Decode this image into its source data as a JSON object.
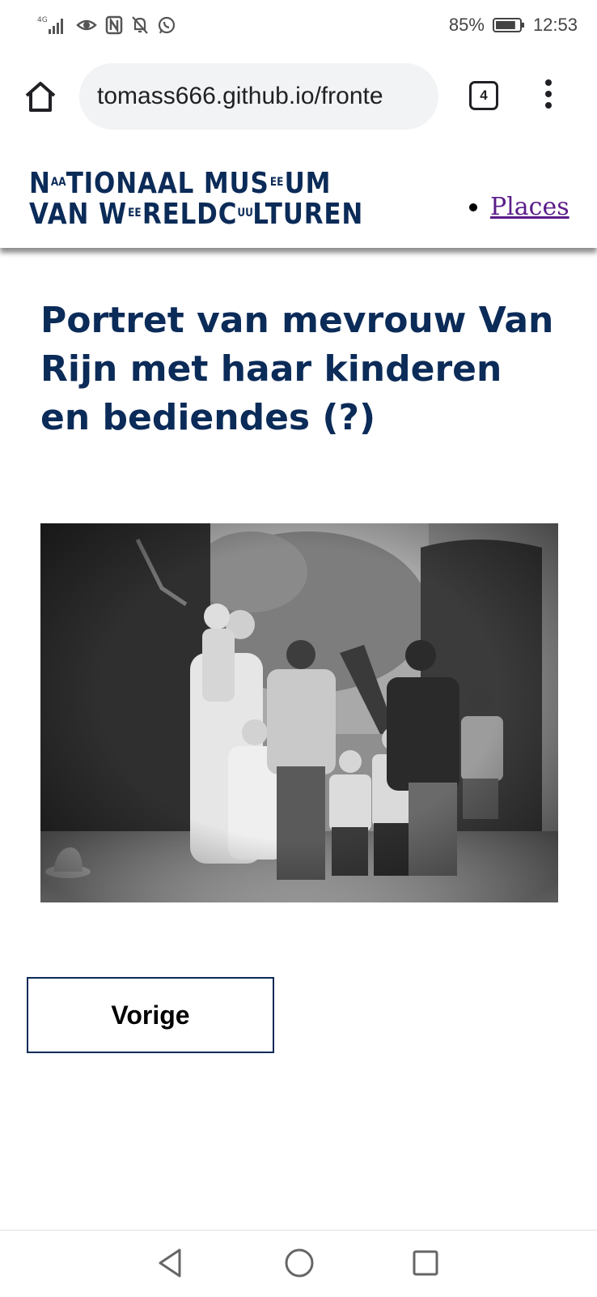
{
  "status_bar": {
    "network": "4G",
    "battery_percent": "85%",
    "battery_level": 0.85,
    "time": "12:53"
  },
  "browser": {
    "url": "tomass666.github.io/fronte",
    "tab_count": "4"
  },
  "site": {
    "logo_line1": [
      "N",
      "AA",
      "TIONAAL MUS",
      "EE",
      "UM"
    ],
    "logo_line2": [
      "VAN W",
      "EE",
      "RELDC",
      "UU",
      "LTUREN"
    ],
    "nav_items": [
      {
        "label": "Places"
      }
    ]
  },
  "main": {
    "title": "Portret van mevrouw Van Rijn met haar kinderen en bediendes (?)",
    "previous_button": "Vorige"
  },
  "colors": {
    "brand_navy": "#0b2b58",
    "link_visited": "#5b1d8a"
  }
}
